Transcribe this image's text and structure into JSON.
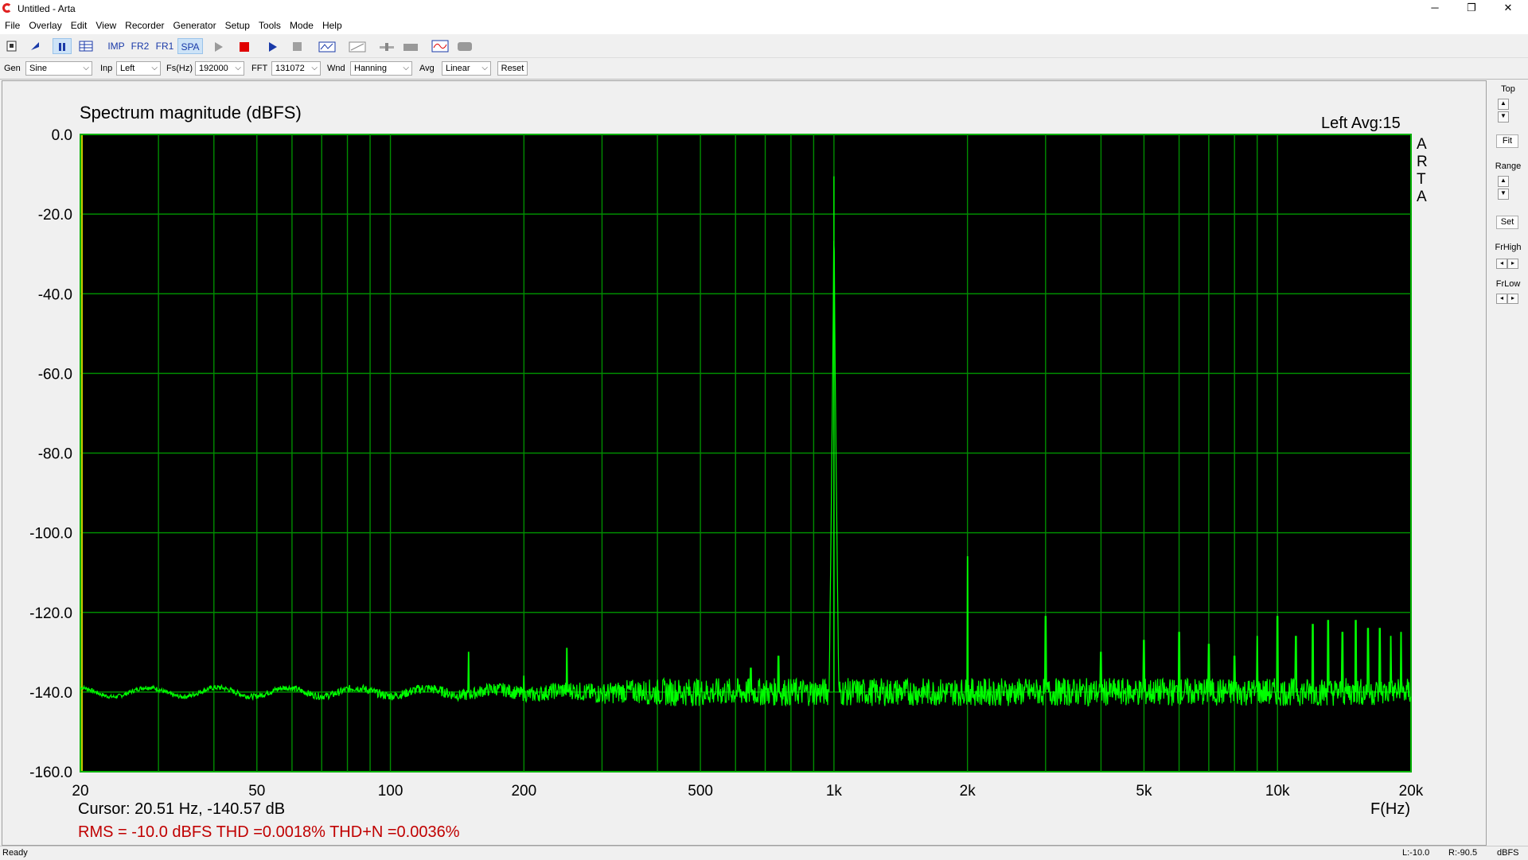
{
  "window": {
    "title": "Untitled - Arta",
    "minimize": "─",
    "restore": "❐",
    "close": "✕"
  },
  "menu": [
    "File",
    "Overlay",
    "Edit",
    "View",
    "Recorder",
    "Generator",
    "Setup",
    "Tools",
    "Mode",
    "Help"
  ],
  "toolbar": {
    "imp": "IMP",
    "fr2": "FR2",
    "fr1": "FR1",
    "spa": "SPA"
  },
  "params": {
    "gen_label": "Gen",
    "gen_value": "Sine",
    "inp_label": "Inp",
    "inp_value": "Left",
    "fs_label": "Fs(Hz)",
    "fs_value": "192000",
    "fft_label": "FFT",
    "fft_value": "131072",
    "wnd_label": "Wnd",
    "wnd_value": "Hanning",
    "avg_label": "Avg",
    "avg_value": "Linear",
    "reset": "Reset"
  },
  "right_panel": {
    "top": "Top",
    "fit": "Fit",
    "range": "Range",
    "set": "Set",
    "frhigh": "FrHigh",
    "frlow": "FrLow"
  },
  "plot": {
    "title": "Spectrum magnitude (dBFS)",
    "channel_info": "Left  Avg:15",
    "brand_letters": [
      "A",
      "R",
      "T",
      "A"
    ],
    "cursor": "Cursor: 20.51 Hz, -140.57 dB",
    "metrics": "RMS =  -10.0 dBFS   THD =0.0018%   THD+N =0.0036%",
    "xunit": "F(Hz)"
  },
  "chart_data": {
    "type": "line",
    "title": "Spectrum magnitude (dBFS)",
    "xlabel": "F(Hz)",
    "ylabel": "",
    "xscale": "log",
    "xlim": [
      20,
      20000
    ],
    "ylim": [
      -160,
      0
    ],
    "x_tick_values": [
      20,
      50,
      100,
      200,
      500,
      1000,
      2000,
      5000,
      10000,
      20000
    ],
    "x_tick_labels": [
      "20",
      "50",
      "100",
      "200",
      "500",
      "1k",
      "2k",
      "5k",
      "10k",
      "20k"
    ],
    "y_tick_values": [
      0,
      -20,
      -40,
      -60,
      -80,
      -100,
      -120,
      -140,
      -160
    ],
    "y_tick_labels": [
      "0.0",
      "-20.0",
      "-40.0",
      "-60.0",
      "-80.0",
      "-100.0",
      "-120.0",
      "-140.0",
      "-160.0"
    ],
    "grid": true,
    "series": [
      {
        "color": "#00ff00",
        "noise_floor_db": -140,
        "peaks": [
          {
            "freq": 150,
            "db": -130
          },
          {
            "freq": 200,
            "db": -136
          },
          {
            "freq": 250,
            "db": -129
          },
          {
            "freq": 650,
            "db": -134
          },
          {
            "freq": 750,
            "db": -131
          },
          {
            "freq": 1000,
            "db": -10.5
          },
          {
            "freq": 2000,
            "db": -106
          },
          {
            "freq": 3000,
            "db": -121
          },
          {
            "freq": 4000,
            "db": -130
          },
          {
            "freq": 5000,
            "db": -127
          },
          {
            "freq": 6000,
            "db": -125
          },
          {
            "freq": 7000,
            "db": -128
          },
          {
            "freq": 8000,
            "db": -131
          },
          {
            "freq": 9000,
            "db": -126
          },
          {
            "freq": 10000,
            "db": -121
          },
          {
            "freq": 11000,
            "db": -126
          },
          {
            "freq": 12000,
            "db": -123
          },
          {
            "freq": 13000,
            "db": -122
          },
          {
            "freq": 14000,
            "db": -125
          },
          {
            "freq": 15000,
            "db": -122
          },
          {
            "freq": 16000,
            "db": -124
          },
          {
            "freq": 17000,
            "db": -124
          },
          {
            "freq": 18000,
            "db": -126
          },
          {
            "freq": 19000,
            "db": -125
          }
        ]
      }
    ]
  },
  "colors": {
    "plot_bg": "#000000",
    "grid": "#008c00",
    "trace": "#00ff00",
    "frame": "#00b000",
    "metrics": "#c00000",
    "cursor_line": "#c8c800"
  },
  "status": {
    "left": "Ready",
    "l": "L:-10.0",
    "r": "R:-90.5",
    "unit": "dBFS"
  }
}
